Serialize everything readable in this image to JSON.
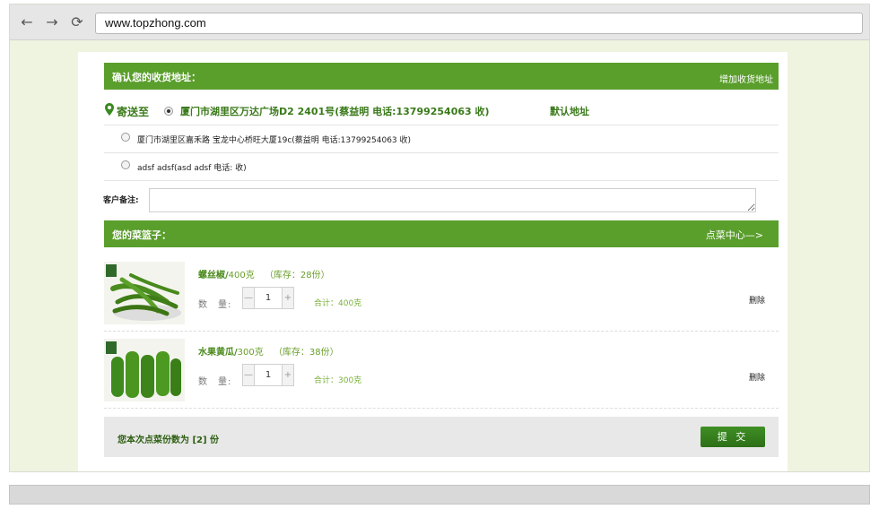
{
  "browser": {
    "url": "www.topzhong.com",
    "back_icon": "←",
    "forward_icon": "→",
    "reload_icon": "⟳"
  },
  "address_section": {
    "title": "确认您的收货地址：",
    "add_link": "增加收货地址",
    "deliver_to_label": "寄送至",
    "selected_address": "厦门市湖里区万达广场D2 2401号(蔡益明 电话:13799254063 收)",
    "default_label": "默认地址",
    "other_addresses": [
      "厦门市湖里区嘉禾路 宝龙中心桥旺大厦19c(蔡益明 电话:13799254063 收)",
      "adsf adsf(asd adsf 电话: 收)"
    ]
  },
  "memo": {
    "label": "客户备注:",
    "value": ""
  },
  "basket": {
    "title": "您的菜篮子：",
    "center_link": "点菜中心—>",
    "quantity_label": "数　量:",
    "minus": "—",
    "plus": "+",
    "delete_label": "删除",
    "items": [
      {
        "name": "螺丝椒/",
        "weight": "400克",
        "stock": "（库存：28份）",
        "quantity": "1",
        "subtotal": "合计：400克"
      },
      {
        "name": "水果黄瓜/",
        "weight": "300克",
        "stock": "（库存：38份）",
        "quantity": "1",
        "subtotal": "合计：300克"
      }
    ]
  },
  "footer": {
    "summary": "您本次点菜份数为 [2] 份",
    "submit_label": "提 交"
  },
  "colors": {
    "accent_green": "#5a9e2c",
    "page_bg": "#eef4e0",
    "submit_green": "#3a8a20"
  }
}
